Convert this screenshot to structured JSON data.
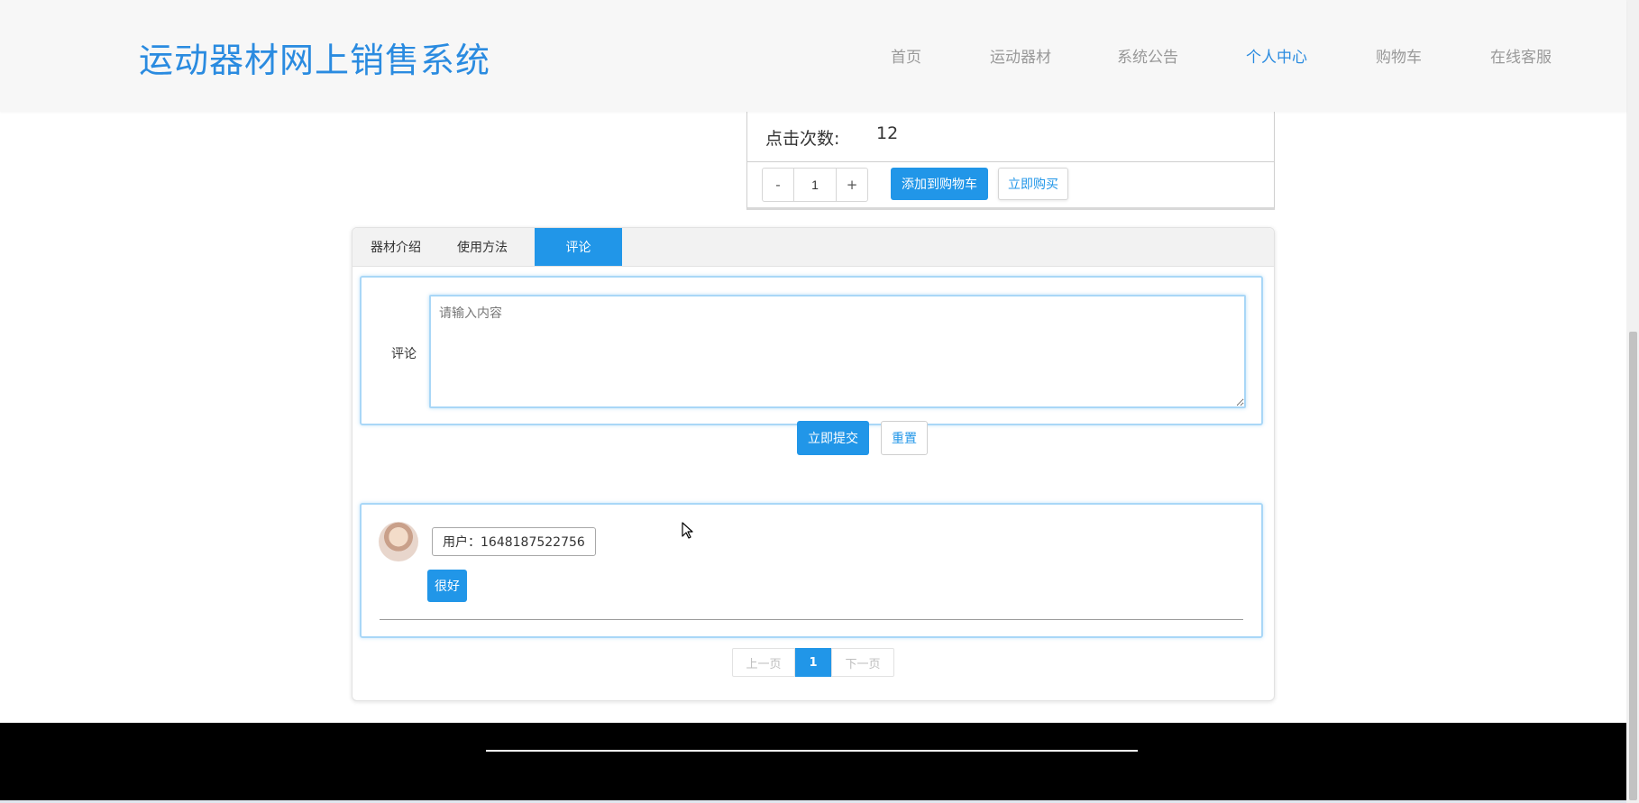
{
  "header": {
    "site_title": "运动器材网上销售系统",
    "nav": [
      {
        "label": "首页",
        "active": false
      },
      {
        "label": "运动器材",
        "active": false
      },
      {
        "label": "系统公告",
        "active": false
      },
      {
        "label": "个人中心",
        "active": true
      },
      {
        "label": "购物车",
        "active": false
      },
      {
        "label": "在线客服",
        "active": false
      }
    ]
  },
  "product": {
    "click_label": "点击次数:",
    "click_count": "12",
    "qty_minus": "-",
    "qty_value": "1",
    "qty_plus": "+",
    "add_to_cart": "添加到购物车",
    "buy_now": "立即购买"
  },
  "tabs": [
    {
      "label": "器材介绍",
      "active": false
    },
    {
      "label": "使用方法",
      "active": false
    },
    {
      "label": "评论",
      "active": true
    }
  ],
  "comment_form": {
    "label": "评论",
    "placeholder": "请输入内容",
    "submit": "立即提交",
    "reset": "重置"
  },
  "comments": [
    {
      "user": "用户：1648187522756",
      "content": "很好"
    }
  ],
  "pagination": {
    "prev": "上一页",
    "current": "1",
    "next": "下一页"
  },
  "colors": {
    "accent": "#2196e8",
    "title": "#2a8be0",
    "footer": "#000000"
  }
}
